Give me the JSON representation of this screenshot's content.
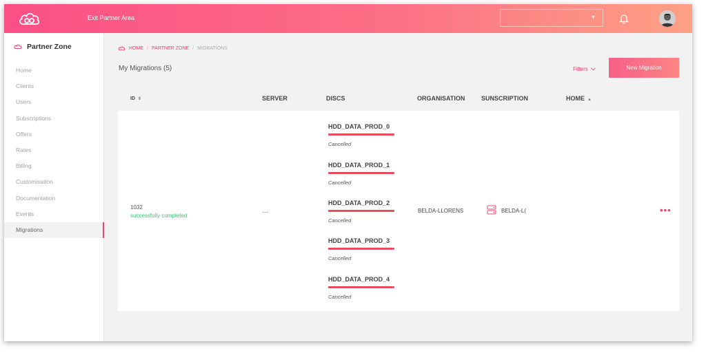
{
  "header": {
    "exit_label": "Exit Partner Area",
    "select_value": "",
    "accent_gradient": [
      "#fb4f86",
      "#fda184"
    ]
  },
  "sidebar": {
    "title": "Partner Zone",
    "items": [
      {
        "label": "Home",
        "active": false
      },
      {
        "label": "Clients",
        "active": false
      },
      {
        "label": "Users",
        "active": false
      },
      {
        "label": "Subscriptions",
        "active": false
      },
      {
        "label": "Offers",
        "active": false
      },
      {
        "label": "Rates",
        "active": false
      },
      {
        "label": "Billing",
        "active": false
      },
      {
        "label": "Customisation",
        "active": false
      },
      {
        "label": "Documentation",
        "active": false
      },
      {
        "label": "Events",
        "active": false
      },
      {
        "label": "Migrations",
        "active": true
      }
    ]
  },
  "breadcrumb": {
    "home": "HOME",
    "sep1": "/",
    "partner_zone": "PARTNER ZONE",
    "sep2": "/",
    "current": "MIGRATIONS"
  },
  "page": {
    "title": "My Migrations (5)",
    "filters_label": "Filters",
    "new_button": "New Migration"
  },
  "table": {
    "headers": {
      "id": "ID",
      "server": "SERVER",
      "discs": "DISCS",
      "organisation": "ORGANISATION",
      "subscription": "SUNSCRIPTION",
      "home": "HOME"
    },
    "row": {
      "id": "1032",
      "status": "successfully completed",
      "server": "---",
      "discs": [
        {
          "name": "HDD_DATA_PROD_0",
          "status": "Cancelled"
        },
        {
          "name": "HDD_DATA_PROD_1",
          "status": "Cancelled"
        },
        {
          "name": "HDD_DATA_PROD_2",
          "status": "Cancelled"
        },
        {
          "name": "HDD_DATA_PROD_3",
          "status": "Cancelled"
        },
        {
          "name": "HDD_DATA_PROD_4",
          "status": "Cancelled"
        }
      ],
      "organisation": "BELDA-LLORENS",
      "subscription": "BELDA-L(",
      "status_color": "#41c27b",
      "more_icon": "more-horizontal-icon"
    }
  }
}
